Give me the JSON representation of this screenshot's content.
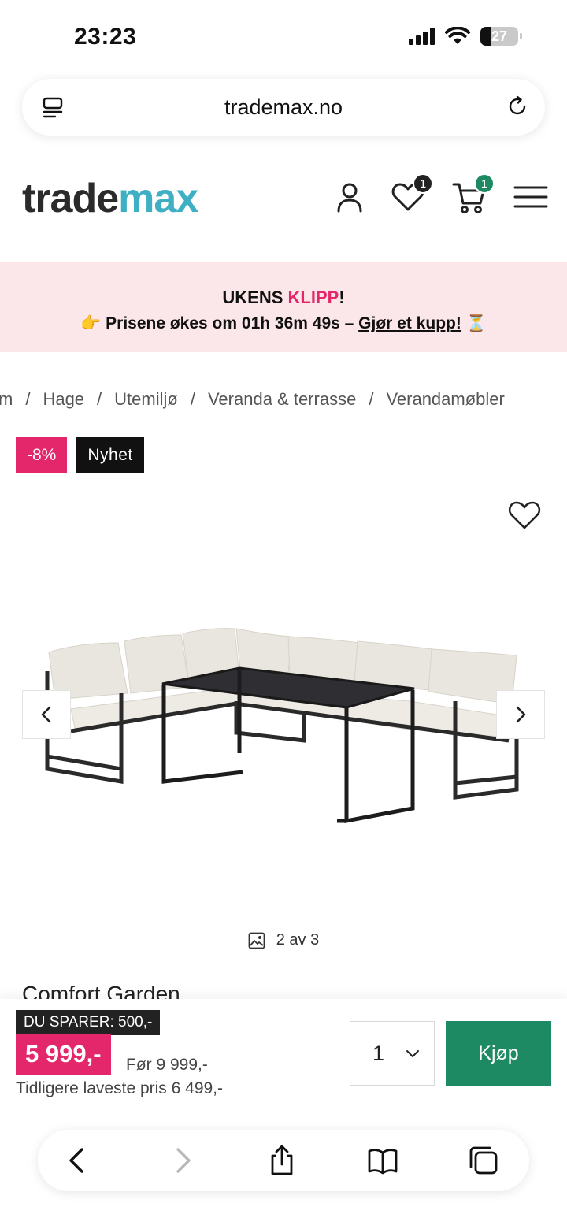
{
  "status_bar": {
    "time": "23:23",
    "battery": "27",
    "battery_level": 0.27,
    "icons": [
      "cellular-signal-icon",
      "wifi-icon",
      "battery-icon"
    ]
  },
  "browser": {
    "url": "trademax.no",
    "left_icon": "reader-menu-icon",
    "right_icon": "reload-icon"
  },
  "header": {
    "logo_part1": "trade",
    "logo_part2": "max",
    "wishlist_count": "1",
    "cart_count": "1",
    "icons": [
      "account-icon",
      "wishlist-heart-icon",
      "cart-icon",
      "hamburger-menu-icon"
    ],
    "colors": {
      "logo_dark": "#2b2b2b",
      "logo_teal": "#3fb0c4",
      "cart_badge": "#1e8a63",
      "wish_badge": "#222222"
    }
  },
  "promo": {
    "title_prefix": "UKENS ",
    "title_accent": "KLIPP",
    "title_suffix": "!",
    "emoji_left": "👉",
    "text": "Prisene økes om 01h 36m 49s – ",
    "link": "Gjør et kupp!",
    "emoji_right": "⏳",
    "background": "#fbe6e9",
    "accent_color": "#e4266a"
  },
  "breadcrumb": {
    "items": [
      "m",
      "Hage",
      "Utemiljø",
      "Veranda & terrasse",
      "Verandamøbler"
    ],
    "separator": "/"
  },
  "badges": {
    "discount": "-8%",
    "new": "Nyhet"
  },
  "gallery": {
    "counter": "2 av 3",
    "prev_icon": "chevron-left-icon",
    "next_icon": "chevron-right-icon"
  },
  "product": {
    "title": "Comfort Garden"
  },
  "buy_bar": {
    "save_label": "DU SPARER: 500,-",
    "price": "5 999,-",
    "before_price": "Før 9 999,-",
    "lowest_price": "Tidligere laveste pris 6 499,-",
    "quantity": "1",
    "buy_label": "Kjøp",
    "buy_color": "#1e8a63"
  },
  "toolbar": {
    "icons": [
      "back-icon",
      "forward-icon",
      "share-icon",
      "bookmarks-icon",
      "tabs-icon"
    ]
  }
}
